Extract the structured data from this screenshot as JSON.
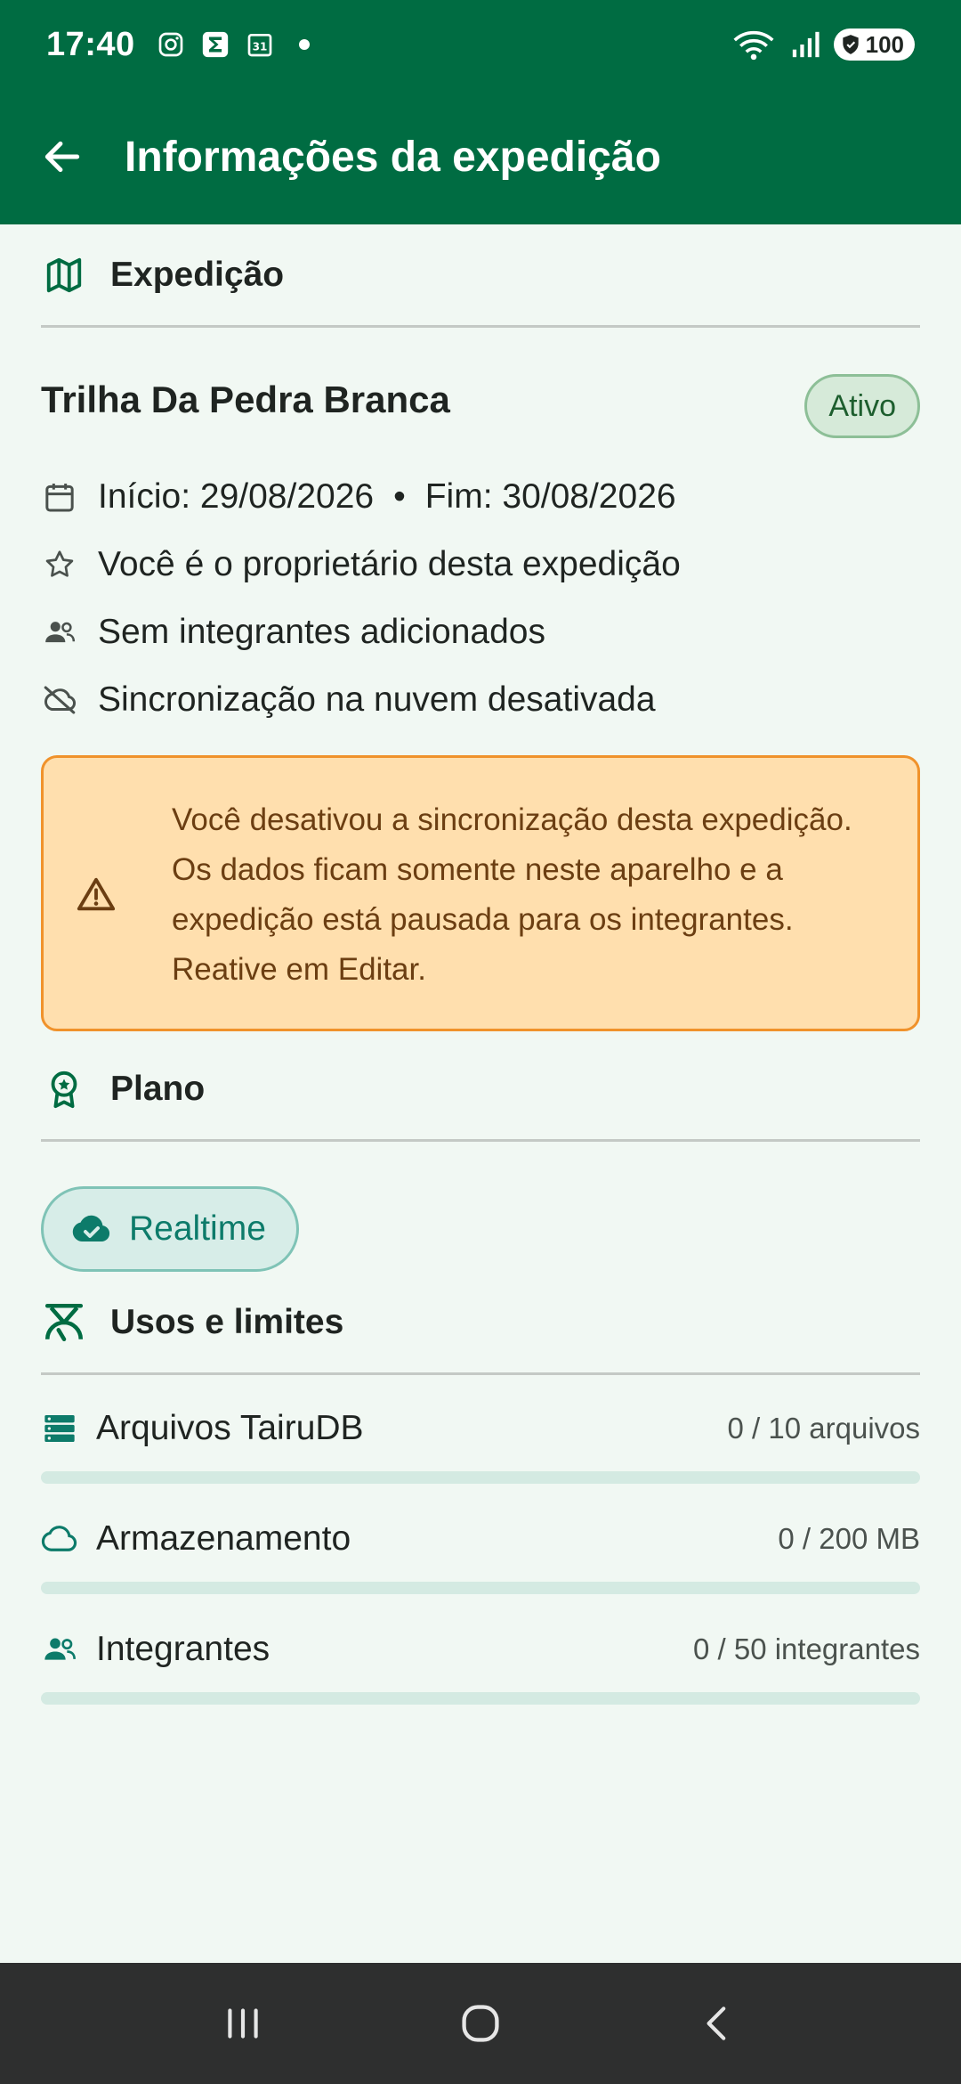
{
  "status_bar": {
    "time": "17:40",
    "battery": "100",
    "icons_left": [
      "instagram-icon",
      "sigma-icon",
      "calendar-31-icon",
      "dot-icon"
    ],
    "icons_right": [
      "wifi-icon",
      "signal-icon",
      "battery-icon"
    ]
  },
  "app_bar": {
    "title": "Informações da expedição",
    "back_icon": "arrow-left-icon",
    "color": "#006C42"
  },
  "expedicao": {
    "section_title": "Expedição",
    "name": "Trilha Da Pedra Branca",
    "status_badge": "Ativo",
    "dates": {
      "start": "Início: 29/08/2026",
      "separator": "•",
      "end": "Fim: 30/08/2026"
    },
    "owner_text": "Você é o proprietário desta expedição",
    "members_text": "Sem integrantes adicionados",
    "sync_text": "Sincronização na nuvem desativada",
    "warning": "Você desativou a sincronização desta expedição. Os dados ficam somente neste aparelho e a expedição está pausada para os integrantes. Reative em Editar."
  },
  "plano": {
    "section_title": "Plano",
    "plan_name": "Realtime"
  },
  "usos": {
    "section_title": "Usos e limites",
    "items": [
      {
        "label": "Arquivos TairuDB",
        "value": "0 / 10 arquivos",
        "progress": 0,
        "icon": "storage-list-icon"
      },
      {
        "label": "Armazenamento",
        "value": "0 / 200 MB",
        "progress": 0,
        "icon": "cloud-icon"
      },
      {
        "label": "Integrantes",
        "value": "0 / 50 integrantes",
        "progress": 0,
        "icon": "people-icon"
      }
    ]
  },
  "colors": {
    "primary": "#006C42",
    "accent_teal": "#0D7B6A",
    "warning_bg": "#FFDFAE",
    "warning_border": "#F0922B"
  }
}
